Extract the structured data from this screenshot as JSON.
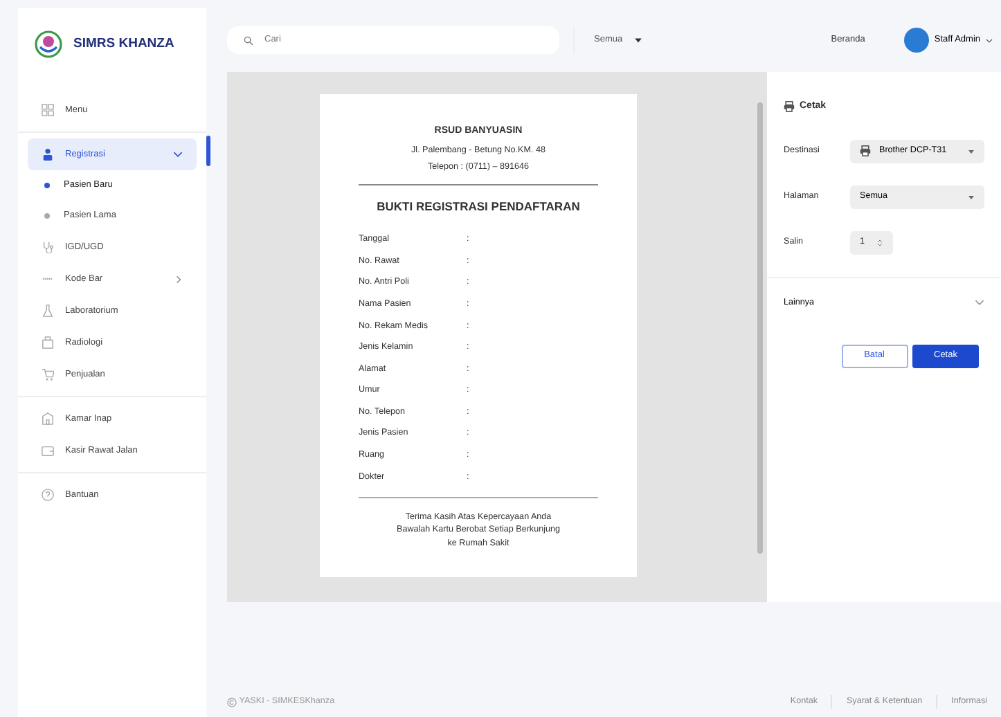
{
  "brand": {
    "name": "SIMRS KHANZA"
  },
  "sidebar": {
    "sections": [
      {
        "items": [
          {
            "label": "Menu",
            "selected": false
          }
        ]
      },
      {
        "items": [
          {
            "label": "Registrasi",
            "selected": true,
            "expanded": true,
            "children": [
              {
                "label": "Pasien Baru",
                "selected": true
              },
              {
                "label": "Pasien Lama",
                "selected": false
              }
            ]
          },
          {
            "label": "IGD/UGD",
            "selected": false
          },
          {
            "label": "Kode Bar",
            "selected": false,
            "expanded": false
          },
          {
            "label": "Laboratorium",
            "selected": false
          },
          {
            "label": "Radiologi",
            "selected": false
          },
          {
            "label": "Penjualan",
            "selected": false
          }
        ]
      },
      {
        "items": [
          {
            "label": "Kamar Inap",
            "selected": false
          },
          {
            "label": "Kasir Rawat Jalan",
            "selected": false
          }
        ]
      },
      {
        "items": [
          {
            "label": "Bantuan",
            "selected": false
          }
        ]
      }
    ]
  },
  "topbar": {
    "search": {
      "placeholder": "Cari"
    },
    "scope": "Semua",
    "links": [
      "Beranda"
    ],
    "user": "Staff Admin"
  },
  "document": {
    "header": [
      "RSUD BANYUASIN",
      "Jl. Palembang - Betung No.KM. 48",
      "Telepon : (0711) – 891646"
    ],
    "title": "BUKTI REGISTRASI PENDAFTARAN",
    "fields": [
      {
        "label": "Tanggal",
        "separator": ":"
      },
      {
        "label": "No. Rawat",
        "separator": ":"
      },
      {
        "label": "No. Antri Poli",
        "separator": ":"
      },
      {
        "label": "Nama Pasien",
        "separator": ":"
      },
      {
        "label": "No. Rekam Medis",
        "separator": ":"
      },
      {
        "label": "Jenis Kelamin",
        "separator": ":"
      },
      {
        "label": "Alamat",
        "separator": ":"
      },
      {
        "label": "Umur",
        "separator": ":"
      },
      {
        "label": "No. Telepon",
        "separator": ":"
      },
      {
        "label": "Jenis Pasien",
        "separator": ":"
      },
      {
        "label": "Ruang",
        "separator": ":"
      },
      {
        "label": "Dokter",
        "separator": ":"
      }
    ],
    "footer": [
      "Terima Kasih Atas Kepercayaan Anda",
      "Bawalah Kartu Berobat Setiap Berkunjung",
      "ke Rumah Sakit"
    ]
  },
  "print_panel": {
    "title": "Cetak",
    "destination": {
      "label": "Destinasi",
      "value": "Brother DCP-T31"
    },
    "pages": {
      "label": "Halaman",
      "value": "Semua"
    },
    "copies": {
      "label": "Salin",
      "value": "1"
    },
    "more": {
      "label": "Lainnya",
      "expanded": false
    },
    "buttons": [
      {
        "label": "Batal",
        "kind": "secondary"
      },
      {
        "label": "Cetak",
        "kind": "primary"
      }
    ]
  },
  "footer": {
    "copyright": "YASKI - SIMKESKhanza",
    "links": [
      "Kontak",
      "Syarat & Ketentuan",
      "Informasi"
    ]
  }
}
